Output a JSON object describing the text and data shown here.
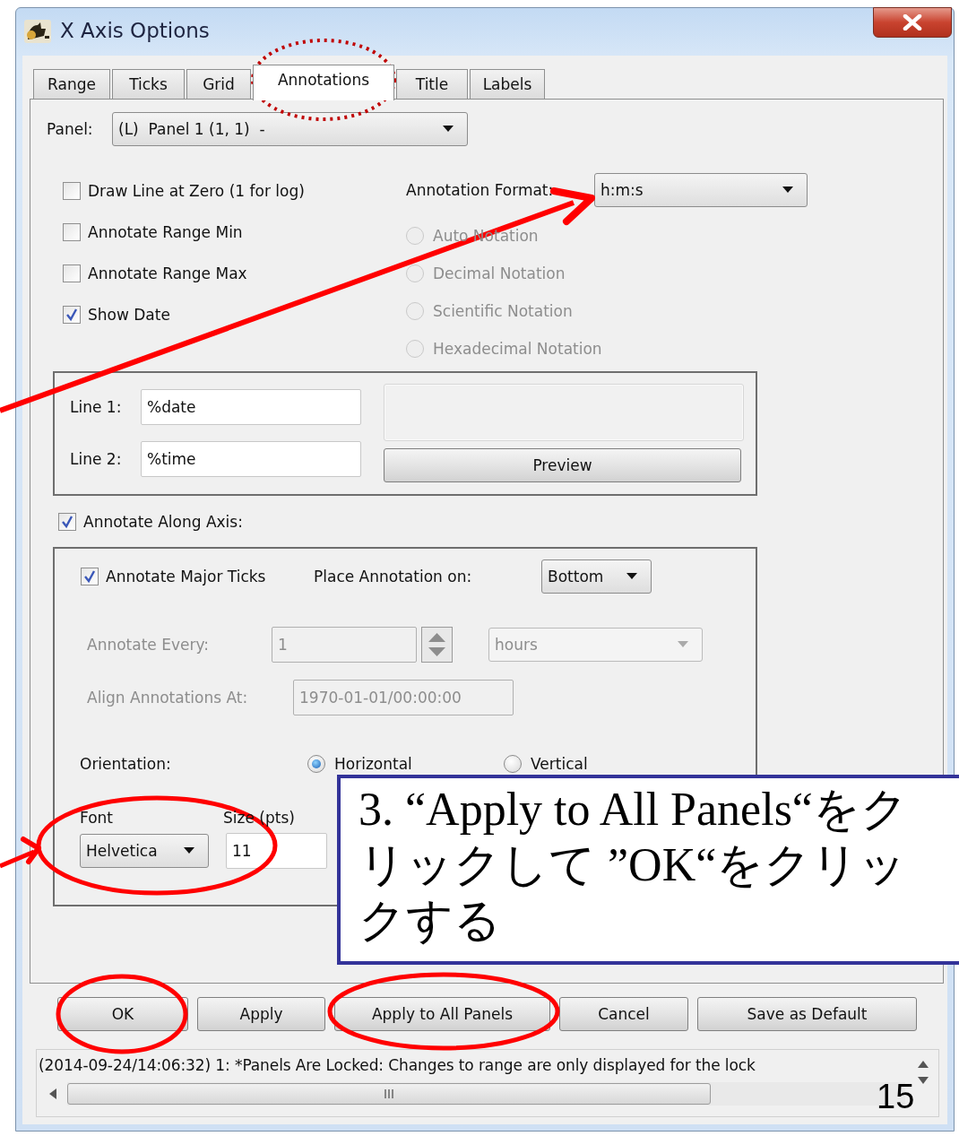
{
  "window": {
    "title": "X Axis Options"
  },
  "tabs": [
    {
      "label": "Range",
      "selected": false
    },
    {
      "label": "Ticks",
      "selected": false
    },
    {
      "label": "Grid",
      "selected": false
    },
    {
      "label": "Annotations",
      "selected": true
    },
    {
      "label": "Title",
      "selected": false
    },
    {
      "label": "Labels",
      "selected": false
    }
  ],
  "panel_select": {
    "label": "Panel:",
    "value": "(L)  Panel 1 (1, 1)  -"
  },
  "options": [
    {
      "label": "Draw Line at Zero (1 for log)",
      "checked": false
    },
    {
      "label": "Annotate Range Min",
      "checked": false
    },
    {
      "label": "Annotate Range Max",
      "checked": false
    },
    {
      "label": "Show Date",
      "checked": true
    }
  ],
  "annotation_format": {
    "label": "Annotation Format:",
    "value": "h:m:s"
  },
  "notations": [
    {
      "label": "Auto Notation",
      "selected": false,
      "disabled": true
    },
    {
      "label": "Decimal Notation",
      "selected": false,
      "disabled": true
    },
    {
      "label": "Scientific Notation",
      "selected": false,
      "disabled": true
    },
    {
      "label": "Hexadecimal Notation",
      "selected": false,
      "disabled": true
    }
  ],
  "lines": [
    {
      "label": "Line 1:",
      "value": "%date"
    },
    {
      "label": "Line 2:",
      "value": "%time"
    }
  ],
  "preview_button": "Preview",
  "annotate_along_axis": {
    "label": "Annotate Along Axis:",
    "checked": true
  },
  "major_ticks": {
    "label": "Annotate Major Ticks",
    "checked": true
  },
  "place_annotation": {
    "label": "Place Annotation on:",
    "value": "Bottom"
  },
  "annotate_every": {
    "label": "Annotate Every:",
    "value": "1",
    "unit": "hours",
    "disabled": true
  },
  "align_at": {
    "label": "Align Annotations At:",
    "value": "1970-01-01/00:00:00",
    "disabled": true
  },
  "orientation": {
    "label": "Orientation:",
    "options": [
      {
        "label": "Horizontal",
        "selected": true
      },
      {
        "label": "Vertical",
        "selected": false
      }
    ]
  },
  "font": {
    "label": "Font",
    "value": "Helvetica"
  },
  "size": {
    "label": "Size (pts)",
    "value": "11"
  },
  "buttons": [
    "OK",
    "Apply",
    "Apply to All Panels",
    "Cancel",
    "Save as Default"
  ],
  "status": "(2014-09-24/14:06:32) 1: *Panels Are Locked: Changes to range are only displayed for the lock",
  "callout": "3. “Apply to All Panels“をクリックして ”OK“をクリックする",
  "page_number": "15"
}
